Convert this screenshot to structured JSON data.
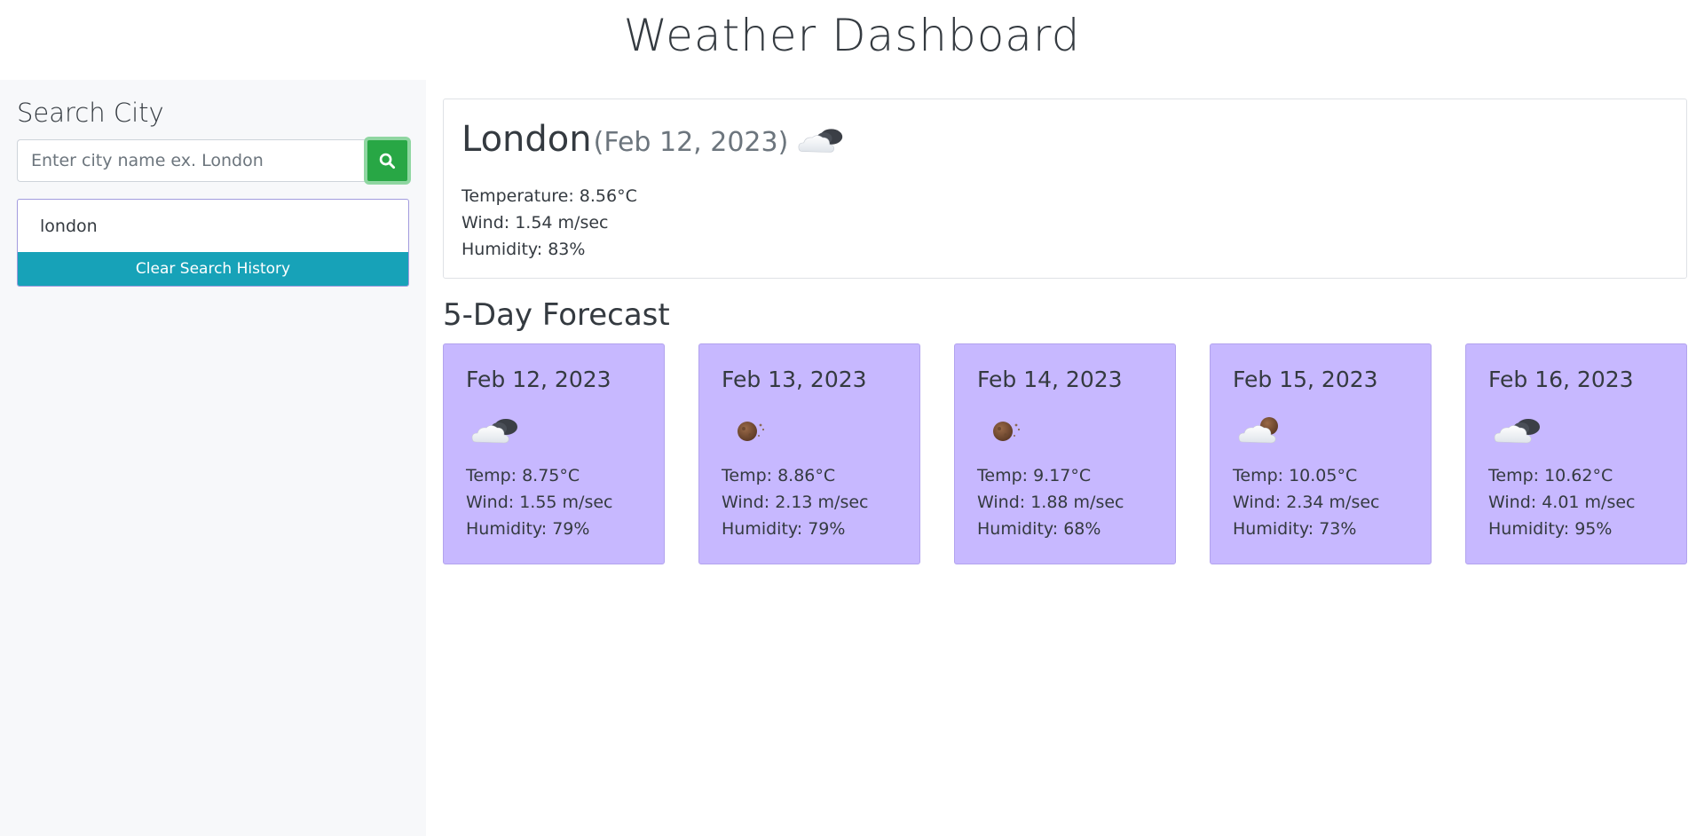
{
  "header": {
    "title": "Weather Dashboard"
  },
  "sidebar": {
    "heading": "Search City",
    "search": {
      "placeholder": "Enter city name ex. London",
      "value": "",
      "button_icon": "search-icon"
    },
    "history": [
      "london"
    ],
    "clear_label": "Clear Search History"
  },
  "current": {
    "city": "London",
    "date": "(Feb 12, 2023)",
    "icon": "partly-cloudy-night-icon",
    "temperature": "Temperature: 8.56°C",
    "wind": "Wind: 1.54 m/sec",
    "humidity": "Humidity: 83%"
  },
  "forecast": {
    "heading": "5-Day Forecast",
    "days": [
      {
        "date": "Feb 12, 2023",
        "icon": "cloudy-night-icon",
        "temp": "Temp: 8.75°C",
        "wind": "Wind: 1.55 m/sec",
        "humidity": "Humidity: 79%"
      },
      {
        "date": "Feb 13, 2023",
        "icon": "moon-icon",
        "temp": "Temp: 8.86°C",
        "wind": "Wind: 2.13 m/sec",
        "humidity": "Humidity: 79%"
      },
      {
        "date": "Feb 14, 2023",
        "icon": "moon-icon",
        "temp": "Temp: 9.17°C",
        "wind": "Wind: 1.88 m/sec",
        "humidity": "Humidity: 68%"
      },
      {
        "date": "Feb 15, 2023",
        "icon": "cloud-moon-icon",
        "temp": "Temp: 10.05°C",
        "wind": "Wind: 2.34 m/sec",
        "humidity": "Humidity: 73%"
      },
      {
        "date": "Feb 16, 2023",
        "icon": "cloudy-night-icon",
        "temp": "Temp: 10.62°C",
        "wind": "Wind: 4.01 m/sec",
        "humidity": "Humidity: 95%"
      }
    ]
  },
  "colors": {
    "search_button": "#28a745",
    "clear_button": "#17a2b8",
    "forecast_card": "#c7b8ff",
    "sidebar_bg": "#f7f8fa"
  }
}
